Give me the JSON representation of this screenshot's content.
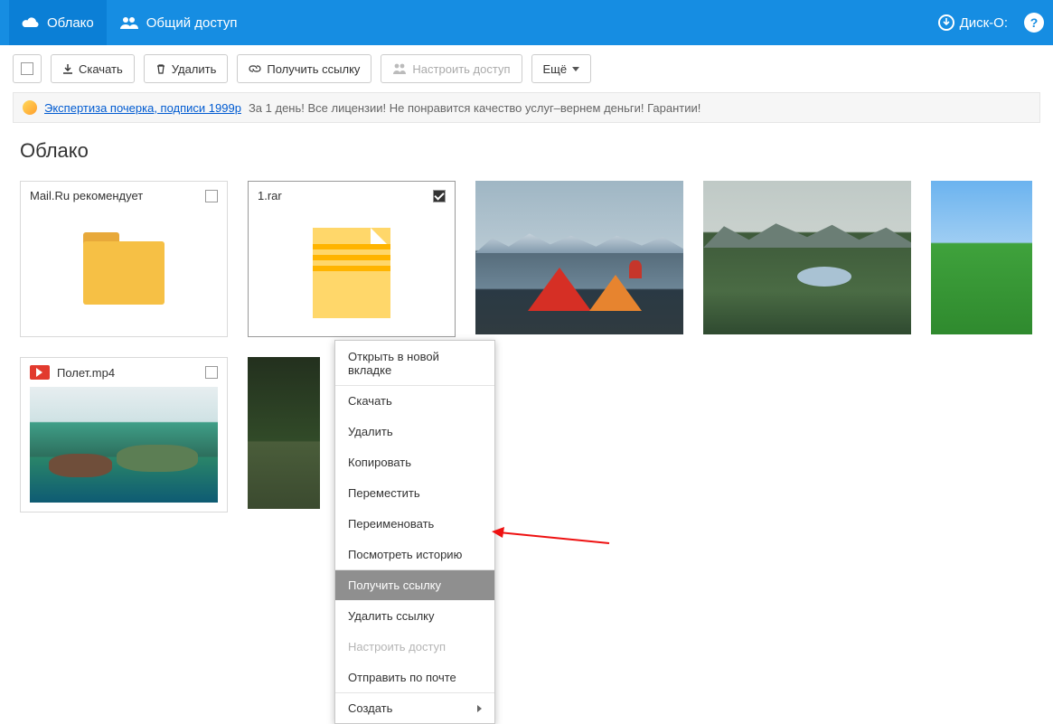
{
  "topbar": {
    "cloud_label": "Облако",
    "share_label": "Общий доступ",
    "disko_label": "Диск-О:"
  },
  "toolbar": {
    "download": "Скачать",
    "delete": "Удалить",
    "getlink": "Получить ссылку",
    "configure": "Настроить доступ",
    "more": "Ещё"
  },
  "ad": {
    "link": "Экспертиза почерка, подписи 1999р",
    "text": "За 1 день! Все лицензии! Не понравится качество услуг–вернем деньги! Гарантии!"
  },
  "page": {
    "title": "Облако"
  },
  "items": {
    "recommend": "Mail.Ru рекомендует",
    "rar": "1.rar",
    "video": "Полет.mp4"
  },
  "context_menu": {
    "open_new_tab": "Открыть в новой вкладке",
    "download": "Скачать",
    "delete": "Удалить",
    "copy": "Копировать",
    "move": "Переместить",
    "rename": "Переименовать",
    "history": "Посмотреть историю",
    "get_link": "Получить ссылку",
    "remove_link": "Удалить ссылку",
    "configure": "Настроить доступ",
    "send_mail": "Отправить по почте",
    "create": "Создать"
  }
}
